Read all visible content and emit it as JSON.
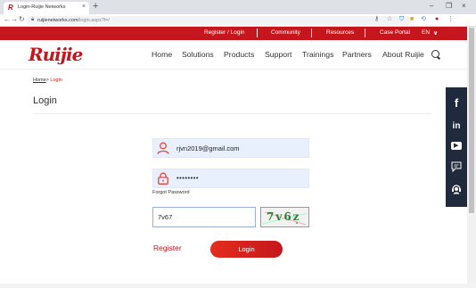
{
  "browser": {
    "tab_favicon": "R",
    "tab_title": "Login-Ruijie Networks",
    "tab_close": "×",
    "new_tab": "+",
    "url_host": "ruijienetworks.com",
    "url_path": "/login.aspx?l=/",
    "window_controls": {
      "minimize": "–",
      "maximize": "❐",
      "close": "×"
    }
  },
  "topbar": {
    "register_login": "Register / Login",
    "community": "Community",
    "resources": "Resources",
    "case_portal": "Case Portal",
    "language": "EN",
    "lang_arrow": "∨"
  },
  "header": {
    "logo": "Ruijie",
    "nav": [
      "Home",
      "Solutions",
      "Products",
      "Support",
      "Trainings",
      "Partners",
      "About Ruijie"
    ]
  },
  "breadcrumb": {
    "home": "Home",
    "separator": ">",
    "current": "Login"
  },
  "page_title": "Login",
  "form": {
    "email_value": "rjvn2019@gmail.com",
    "password_value": "••••••••",
    "forgot_password": "Forgot Password",
    "captcha_value": "7v67",
    "captcha_text": "7v6z",
    "register": "Register",
    "login_button": "Login"
  },
  "social": {
    "facebook": "f",
    "linkedin": "in",
    "youtube": "▶"
  },
  "colors": {
    "brand_red": "#c4161c",
    "social_bg": "#1f2a3d",
    "field_bg": "#e8f0fe"
  }
}
